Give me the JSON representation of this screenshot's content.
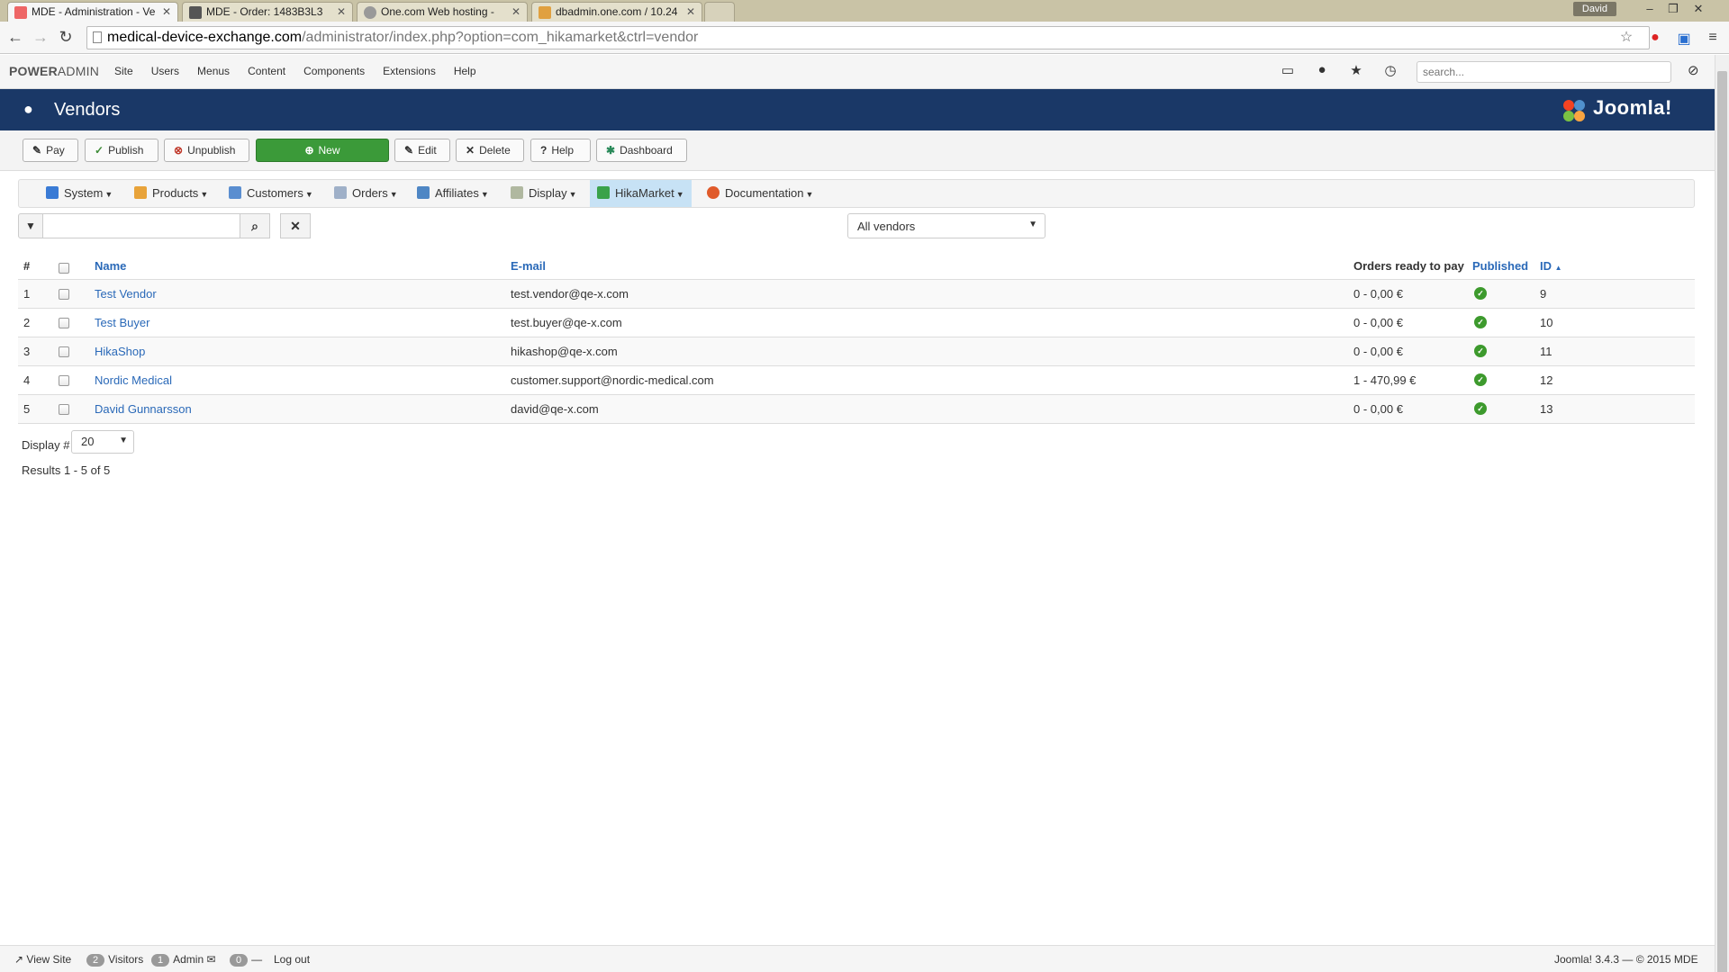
{
  "browser": {
    "tabs": [
      {
        "title": "MDE - Administration - Ve",
        "active": true
      },
      {
        "title": "MDE - Order: 1483B3L3",
        "active": false
      },
      {
        "title": "One.com Web hosting  -",
        "active": false
      },
      {
        "title": "dbadmin.one.com / 10.24",
        "active": false
      }
    ],
    "user": "David",
    "url_domain": "medical-device-exchange.com",
    "url_path": "/administrator/index.php?option=com_hikamarket&ctrl=vendor"
  },
  "admin_nav": {
    "brand_bold": "POWER",
    "brand_light": "ADMIN",
    "menu": [
      "Site",
      "Users",
      "Menus",
      "Content",
      "Components",
      "Extensions",
      "Help"
    ],
    "search_placeholder": "search..."
  },
  "header": {
    "title": "Vendors",
    "logo_text": "Joomla!"
  },
  "toolbar": {
    "pay": "Pay",
    "publish": "Publish",
    "unpublish": "Unpublish",
    "new": "New",
    "edit": "Edit",
    "delete": "Delete",
    "help": "Help",
    "dashboard": "Dashboard"
  },
  "hikamenu": [
    {
      "label": "System",
      "color": "#3a7bd5"
    },
    {
      "label": "Products",
      "color": "#e8a33a"
    },
    {
      "label": "Customers",
      "color": "#5a8ed0"
    },
    {
      "label": "Orders",
      "color": "#9fb0c8"
    },
    {
      "label": "Affiliates",
      "color": "#4e86c4"
    },
    {
      "label": "Display",
      "color": "#b0b8a0"
    },
    {
      "label": "HikaMarket",
      "color": "#3aa24a"
    },
    {
      "label": "Documentation",
      "color": "#e05a2a"
    }
  ],
  "filter": {
    "vendor_select": "All vendors"
  },
  "table": {
    "headers": {
      "num": "#",
      "name": "Name",
      "email": "E-mail",
      "orders": "Orders ready to pay",
      "published": "Published",
      "id": "ID"
    },
    "rows": [
      {
        "num": "1",
        "name": "Test Vendor",
        "email": "test.vendor@qe-x.com",
        "orders": "0 - 0,00 €",
        "id": "9"
      },
      {
        "num": "2",
        "name": "Test Buyer",
        "email": "test.buyer@qe-x.com",
        "orders": "0 - 0,00 €",
        "id": "10"
      },
      {
        "num": "3",
        "name": "HikaShop",
        "email": "hikashop@qe-x.com",
        "orders": "0 - 0,00 €",
        "id": "11"
      },
      {
        "num": "4",
        "name": "Nordic Medical",
        "email": "customer.support@nordic-medical.com",
        "orders": "1 - 470,99 €",
        "id": "12"
      },
      {
        "num": "5",
        "name": "David Gunnarsson",
        "email": "david@qe-x.com",
        "orders": "0 - 0,00 €",
        "id": "13"
      }
    ]
  },
  "pagination": {
    "display_label": "Display #",
    "display_value": "20",
    "results": "Results 1 - 5 of 5"
  },
  "status": {
    "view_site": "View Site",
    "visitors_count": "2",
    "visitors": "Visitors",
    "admin_count": "1",
    "admin": "Admin",
    "messages_count": "0",
    "logout": "Log out",
    "version": "Joomla! 3.4.3 — © 2015 MDE"
  }
}
